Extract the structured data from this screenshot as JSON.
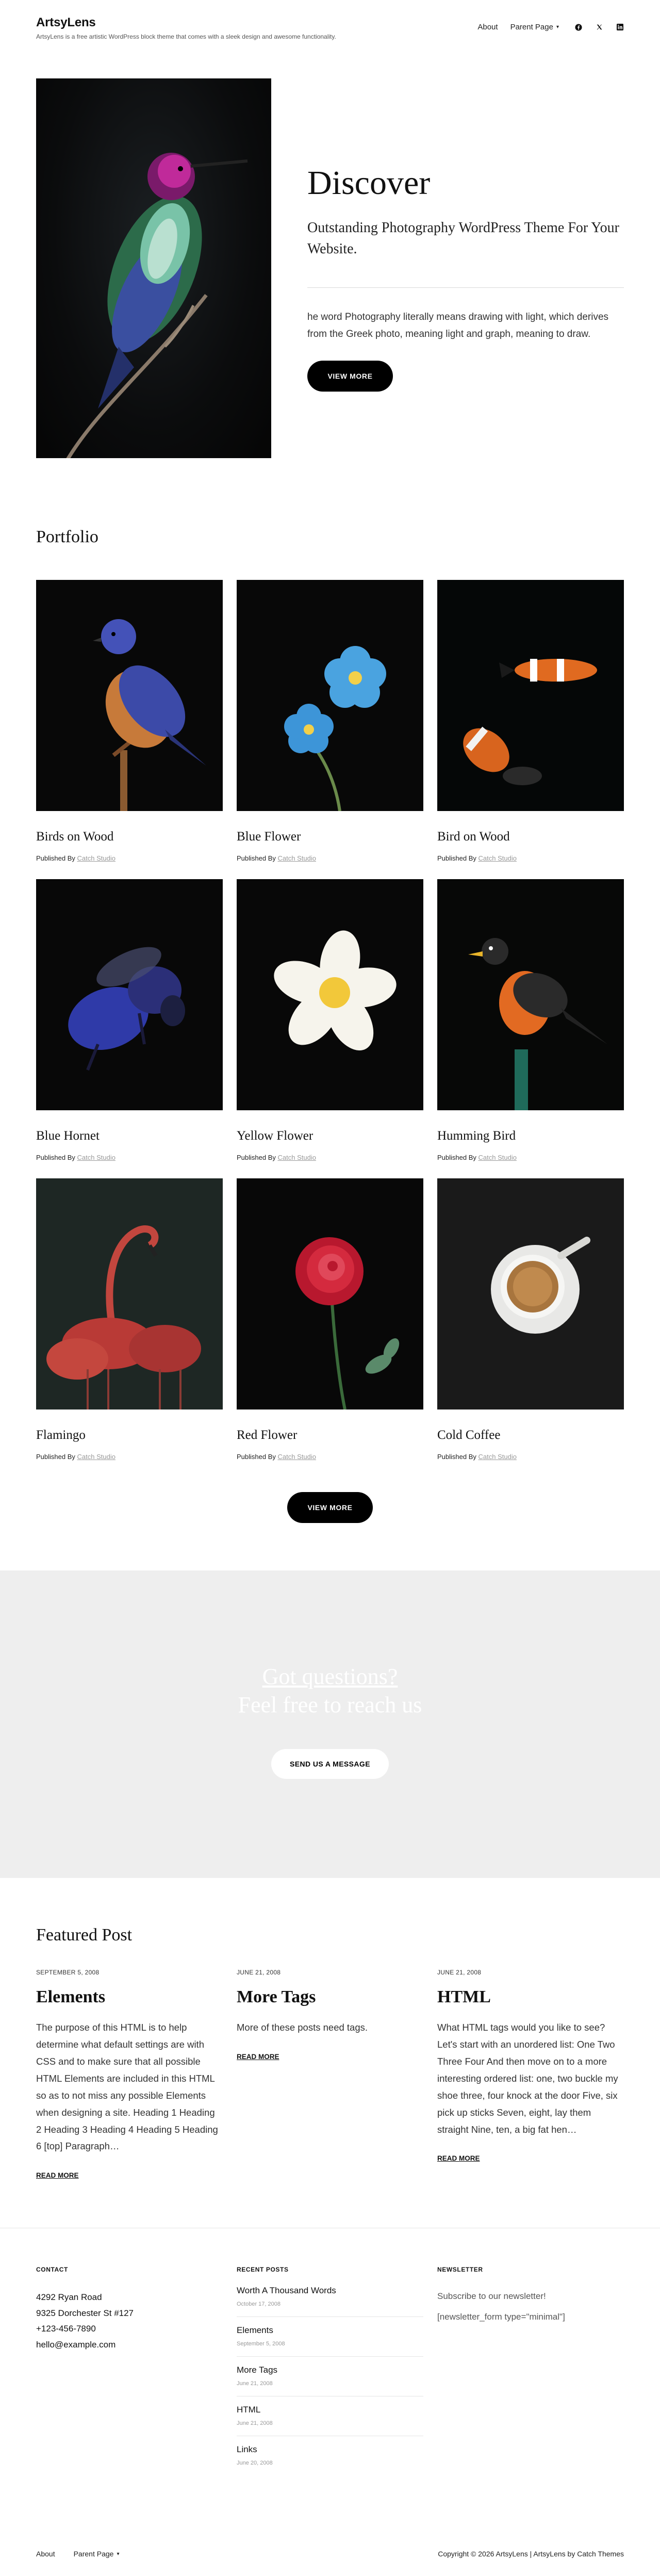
{
  "site": {
    "title": "ArtsyLens",
    "tagline": "ArtsyLens is a free artistic WordPress block theme that comes with a sleek design and awesome functionality."
  },
  "nav": {
    "items": [
      "About",
      "Parent Page"
    ],
    "social_icons": [
      "facebook-icon",
      "x-twitter-icon",
      "linkedin-icon"
    ]
  },
  "hero": {
    "title": "Discover",
    "subtitle": "Outstanding Photography WordPress Theme For Your Website.",
    "body": "he word Photography literally means drawing with light, which derives from the Greek photo, meaning light and graph, meaning to draw.",
    "button": "VIEW MORE"
  },
  "portfolio": {
    "heading": "Portfolio",
    "published_by_label": "Published By",
    "author": "Catch Studio",
    "items": [
      {
        "title": "Birds on Wood",
        "image": "bluebird-on-branch"
      },
      {
        "title": "Blue Flower",
        "image": "blue-forget-me-not"
      },
      {
        "title": "Bird on Wood",
        "image": "clownfish"
      },
      {
        "title": "Blue Hornet",
        "image": "blue-bee"
      },
      {
        "title": "Yellow Flower",
        "image": "frangipani"
      },
      {
        "title": "Humming Bird",
        "image": "robin-on-post"
      },
      {
        "title": "Flamingo",
        "image": "flamingos"
      },
      {
        "title": "Red Flower",
        "image": "red-rose"
      },
      {
        "title": "Cold Coffee",
        "image": "coffee-cup"
      }
    ],
    "button": "VIEW MORE"
  },
  "cta": {
    "line1": "Got questions?",
    "line2": "Feel free to reach us",
    "button": "SEND US A MESSAGE"
  },
  "featured": {
    "heading": "Featured Post",
    "read_more": "READ MORE",
    "posts": [
      {
        "date": "SEPTEMBER 5, 2008",
        "title": "Elements",
        "excerpt": "The purpose of this HTML is to help determine what default settings are with CSS and to make sure that all possible HTML Elements are included in this HTML so as to not miss any possible Elements when designing a site. Heading 1 Heading 2 Heading 3 Heading 4 Heading 5 Heading 6 [top] Paragraph…"
      },
      {
        "date": "JUNE 21, 2008",
        "title": "More Tags",
        "excerpt": "More of these posts need tags."
      },
      {
        "date": "JUNE 21, 2008",
        "title": "HTML",
        "excerpt": "What HTML tags would you like to see? Let's start with an unordered list: One Two Three Four And then move on to a more interesting ordered list: one, two buckle my shoe three, four knock at the door Five, six pick up sticks Seven, eight, lay them straight Nine, ten, a big fat hen…"
      }
    ]
  },
  "footer": {
    "contact": {
      "title": "CONTACT",
      "lines": [
        "4292 Ryan Road",
        "9325 Dorchester St #127",
        "+123-456-7890",
        "hello@example.com"
      ]
    },
    "recent_posts": {
      "title": "RECENT POSTS",
      "items": [
        {
          "title": "Worth A Thousand Words",
          "date": "October 17, 2008"
        },
        {
          "title": "Elements",
          "date": "September 5, 2008"
        },
        {
          "title": "More Tags",
          "date": "June 21, 2008"
        },
        {
          "title": "HTML",
          "date": "June 21, 2008"
        },
        {
          "title": "Links",
          "date": "June 20, 2008"
        }
      ]
    },
    "newsletter": {
      "title": "NEWSLETTER",
      "text": "Subscribe to our newsletter!",
      "shortcode": "[newsletter_form type=\"minimal\"]"
    },
    "bottom_nav": [
      "About",
      "Parent Page"
    ],
    "copyright": "Copyright © 2026 ArtsyLens | ArtsyLens by Catch Themes"
  }
}
